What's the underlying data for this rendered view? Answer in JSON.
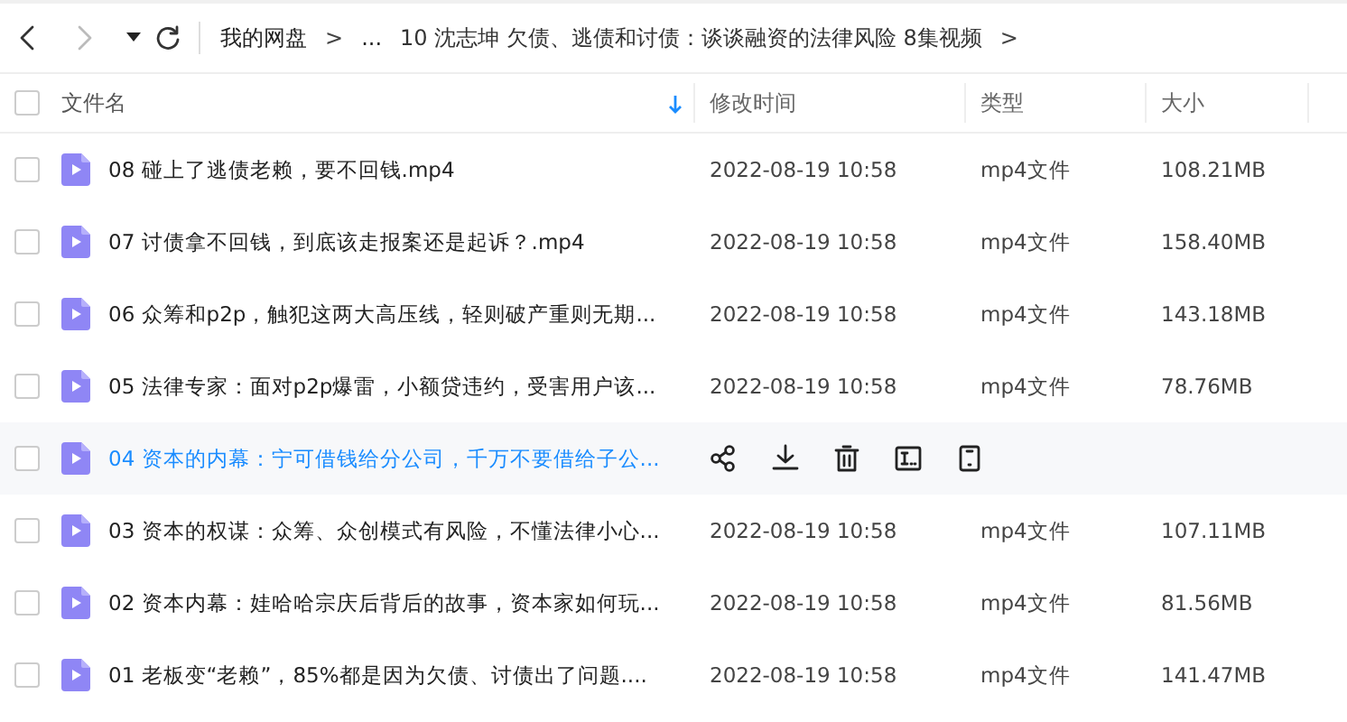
{
  "nav": {
    "back": {
      "disabled": false
    },
    "forward": {
      "disabled": true
    }
  },
  "breadcrumb": [
    {
      "label": "我的网盘",
      "kind": "link"
    },
    {
      "label": ">",
      "kind": "sep"
    },
    {
      "label": "...",
      "kind": "link"
    },
    {
      "label": "10 沈志坤 欠债、逃债和讨债：谈谈融资的法律风险 8集视频",
      "kind": "current"
    },
    {
      "label": ">",
      "kind": "sep"
    }
  ],
  "table": {
    "columns": [
      {
        "label": "文件名",
        "sorted": true
      },
      {
        "label": "修改时间",
        "sorted": false
      },
      {
        "label": "类型",
        "sorted": false
      },
      {
        "label": "大小",
        "sorted": false
      }
    ],
    "select_all": {
      "checked": false
    },
    "rows": [
      {
        "name": "08 碰上了逃债老赖，要不回钱.mp4",
        "modified": "2022-08-19 10:58",
        "type": "mp4文件",
        "size": "108.21MB",
        "checked": false,
        "hovered": false
      },
      {
        "name": "07 讨债拿不回钱，到底该走报案还是起诉？.mp4",
        "modified": "2022-08-19 10:58",
        "type": "mp4文件",
        "size": "158.40MB",
        "checked": false,
        "hovered": false
      },
      {
        "name": "06 众筹和p2p，触犯这两大高压线，轻则破产重则无期...",
        "modified": "2022-08-19 10:58",
        "type": "mp4文件",
        "size": "143.18MB",
        "checked": false,
        "hovered": false
      },
      {
        "name": "05 法律专家：面对p2p爆雷，小额贷违约，受害用户该...",
        "modified": "2022-08-19 10:58",
        "type": "mp4文件",
        "size": "78.76MB",
        "checked": false,
        "hovered": false
      },
      {
        "name": "04 资本的内幕：宁可借钱给分公司，千万不要借给子公...",
        "checked": false,
        "hovered": true
      },
      {
        "name": "03 资本的权谋：众筹、众创模式有风险，不懂法律小心...",
        "modified": "2022-08-19 10:58",
        "type": "mp4文件",
        "size": "107.11MB",
        "checked": false,
        "hovered": false
      },
      {
        "name": "02 资本内幕：娃哈哈宗庆后背后的故事，资本家如何玩...",
        "modified": "2022-08-19 10:58",
        "type": "mp4文件",
        "size": "81.56MB",
        "checked": false,
        "hovered": false
      },
      {
        "name": "01 老板变“老赖”，85%都是因为欠债、讨债出了问题....",
        "modified": "2022-08-19 10:58",
        "type": "mp4文件",
        "size": "141.47MB",
        "checked": false,
        "hovered": false
      }
    ]
  }
}
